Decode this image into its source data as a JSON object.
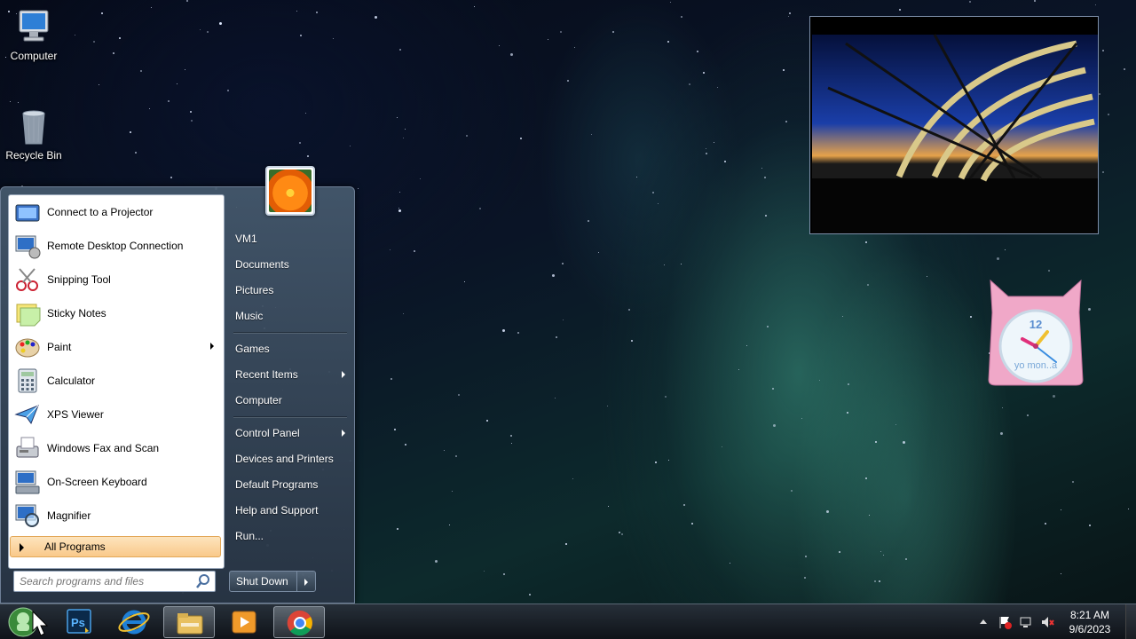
{
  "desktop": {
    "icons": [
      {
        "label": "Computer"
      },
      {
        "label": "Recycle Bin"
      }
    ]
  },
  "clock_gadget": {
    "number": "12",
    "brand": "yo mon..a"
  },
  "start_menu": {
    "programs": [
      {
        "label": "Connect to a Projector",
        "icon": "projector-icon"
      },
      {
        "label": "Remote Desktop Connection",
        "icon": "remote-desktop-icon"
      },
      {
        "label": "Snipping Tool",
        "icon": "scissors-icon"
      },
      {
        "label": "Sticky Notes",
        "icon": "sticky-notes-icon"
      },
      {
        "label": "Paint",
        "icon": "paint-palette-icon",
        "submenu": true
      },
      {
        "label": "Calculator",
        "icon": "calculator-icon"
      },
      {
        "label": "XPS Viewer",
        "icon": "xps-viewer-icon"
      },
      {
        "label": "Windows Fax and Scan",
        "icon": "fax-icon"
      },
      {
        "label": "On-Screen Keyboard",
        "icon": "keyboard-icon"
      },
      {
        "label": "Magnifier",
        "icon": "magnifier-icon"
      }
    ],
    "all_programs": "All Programs",
    "search_placeholder": "Search programs and files",
    "right_items": [
      {
        "label": "VM1"
      },
      {
        "label": "Documents"
      },
      {
        "label": "Pictures"
      },
      {
        "label": "Music"
      },
      {
        "label": "Games"
      },
      {
        "label": "Recent Items",
        "submenu": true
      },
      {
        "label": "Computer"
      },
      {
        "label": "Control Panel",
        "submenu": true
      },
      {
        "label": "Devices and Printers"
      },
      {
        "label": "Default Programs"
      },
      {
        "label": "Help and Support"
      },
      {
        "label": "Run..."
      }
    ],
    "shutdown_label": "Shut Down"
  },
  "taskbar": {
    "pinned": [
      {
        "name": "photoshop-icon",
        "label": "Ps"
      },
      {
        "name": "internet-explorer-icon"
      },
      {
        "name": "file-explorer-icon",
        "active": true
      },
      {
        "name": "media-player-icon"
      },
      {
        "name": "chrome-icon",
        "active": true
      }
    ],
    "time": "8:21 AM",
    "date": "9/6/2023"
  }
}
